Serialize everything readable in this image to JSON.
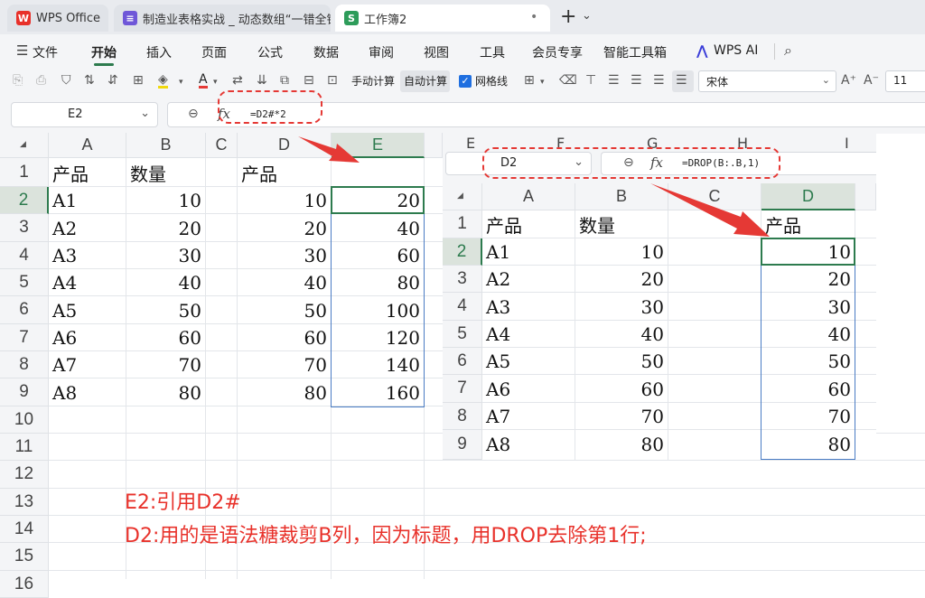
{
  "tabs": [
    {
      "label": "WPS Office",
      "icon": "wps-logo-icon"
    },
    {
      "label": "制造业表格实战 _ 动态数组“一错全错",
      "icon": "doc-icon"
    },
    {
      "label": "工作簿2",
      "icon": "sheet-icon",
      "close": "•"
    }
  ],
  "tab_controls": {
    "new_tab": "+",
    "more": "⌄"
  },
  "menu": {
    "file": "文件",
    "items": [
      "开始",
      "插入",
      "页面",
      "公式",
      "数据",
      "审阅",
      "视图",
      "工具",
      "会员专享",
      "智能工具箱"
    ],
    "active": "开始",
    "wps_ai": "WPS AI"
  },
  "toolbar": {
    "manual_calc": "手动计算",
    "auto_calc": "自动计算",
    "gridlines": "网格线",
    "gridlines_checked": true,
    "font_name": "宋体",
    "font_size": "11"
  },
  "formula_bar": {
    "cell_ref": "E2",
    "formula": "=D2#*2"
  },
  "main_sheet": {
    "columns": [
      "A",
      "B",
      "C",
      "D",
      "E"
    ],
    "selected_column": "E",
    "rows": [
      "1",
      "2",
      "3",
      "4",
      "5",
      "6",
      "7",
      "8",
      "9",
      "10",
      "11",
      "12",
      "13",
      "14",
      "15",
      "16"
    ],
    "selected_row": "2",
    "header_row": {
      "A": "产品",
      "B": "数量",
      "D": "产品"
    },
    "data": [
      {
        "A": "A1",
        "B": "10",
        "D": "10",
        "E": "20"
      },
      {
        "A": "A2",
        "B": "20",
        "D": "20",
        "E": "40"
      },
      {
        "A": "A3",
        "B": "30",
        "D": "30",
        "E": "60"
      },
      {
        "A": "A4",
        "B": "40",
        "D": "40",
        "E": "80"
      },
      {
        "A": "A5",
        "B": "50",
        "D": "50",
        "E": "100"
      },
      {
        "A": "A6",
        "B": "60",
        "D": "60",
        "E": "120"
      },
      {
        "A": "A7",
        "B": "70",
        "D": "70",
        "E": "140"
      },
      {
        "A": "A8",
        "B": "80",
        "D": "80",
        "E": "160"
      }
    ]
  },
  "inset_sheet": {
    "partial_columns": [
      "E",
      "F",
      "G",
      "H",
      "I"
    ],
    "cell_ref": "D2",
    "formula": "=DROP(B:.B,1)",
    "columns": [
      "A",
      "B",
      "C",
      "D"
    ],
    "selected_column": "D",
    "rows": [
      "1",
      "2",
      "3",
      "4",
      "5",
      "6",
      "7",
      "8",
      "9"
    ],
    "selected_row": "2",
    "header_row": {
      "A": "产品",
      "B": "数量",
      "D": "产品"
    },
    "data": [
      {
        "A": "A1",
        "B": "10",
        "D": "10"
      },
      {
        "A": "A2",
        "B": "20",
        "D": "20"
      },
      {
        "A": "A3",
        "B": "30",
        "D": "30"
      },
      {
        "A": "A4",
        "B": "40",
        "D": "40"
      },
      {
        "A": "A5",
        "B": "50",
        "D": "50"
      },
      {
        "A": "A6",
        "B": "60",
        "D": "60"
      },
      {
        "A": "A7",
        "B": "70",
        "D": "70"
      },
      {
        "A": "A8",
        "B": "80",
        "D": "80"
      }
    ]
  },
  "notes": {
    "line1": "E2:引用D2#",
    "line2": "D2:用的是语法糖裁剪B列，因为标题，用DROP去除第1行;"
  },
  "colors": {
    "accent_green": "#2d7b4e",
    "annotation_red": "#e53935",
    "spill_blue": "#4a7cc4"
  }
}
